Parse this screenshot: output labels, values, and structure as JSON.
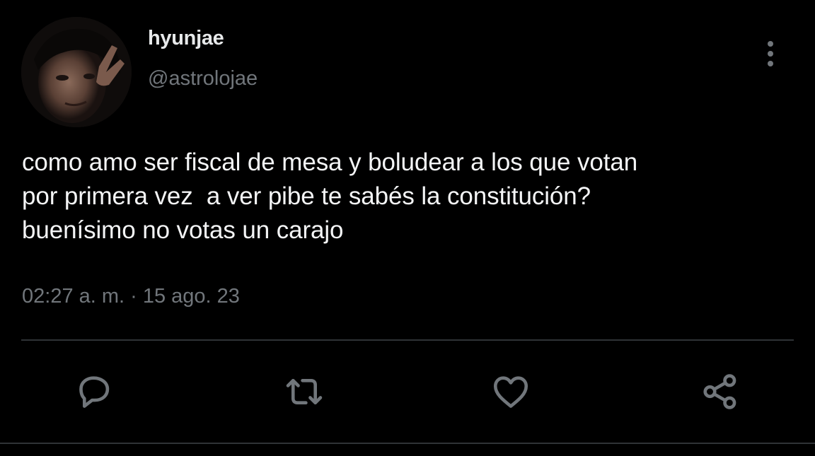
{
  "tweet": {
    "author": {
      "display_name": "hyunjae",
      "handle": "@astrolojae",
      "avatar": "avatar-photo"
    },
    "text_lines": [
      "como amo ser fiscal de mesa y boludear a los que votan",
      "por primera vez  a ver pibe te sabés la constitución?",
      "buenísimo no votas un carajo"
    ],
    "timestamp": "02:27 a. m. · 15 ago. 23"
  },
  "actions": {
    "more": "more-vertical-icon",
    "reply": "reply-icon",
    "retweet": "retweet-icon",
    "like": "heart-icon",
    "share": "share-icon"
  },
  "colors": {
    "background": "#000000",
    "text_primary": "#e7e9ea",
    "text_secondary": "#71767b",
    "divider": "#2f3336"
  }
}
